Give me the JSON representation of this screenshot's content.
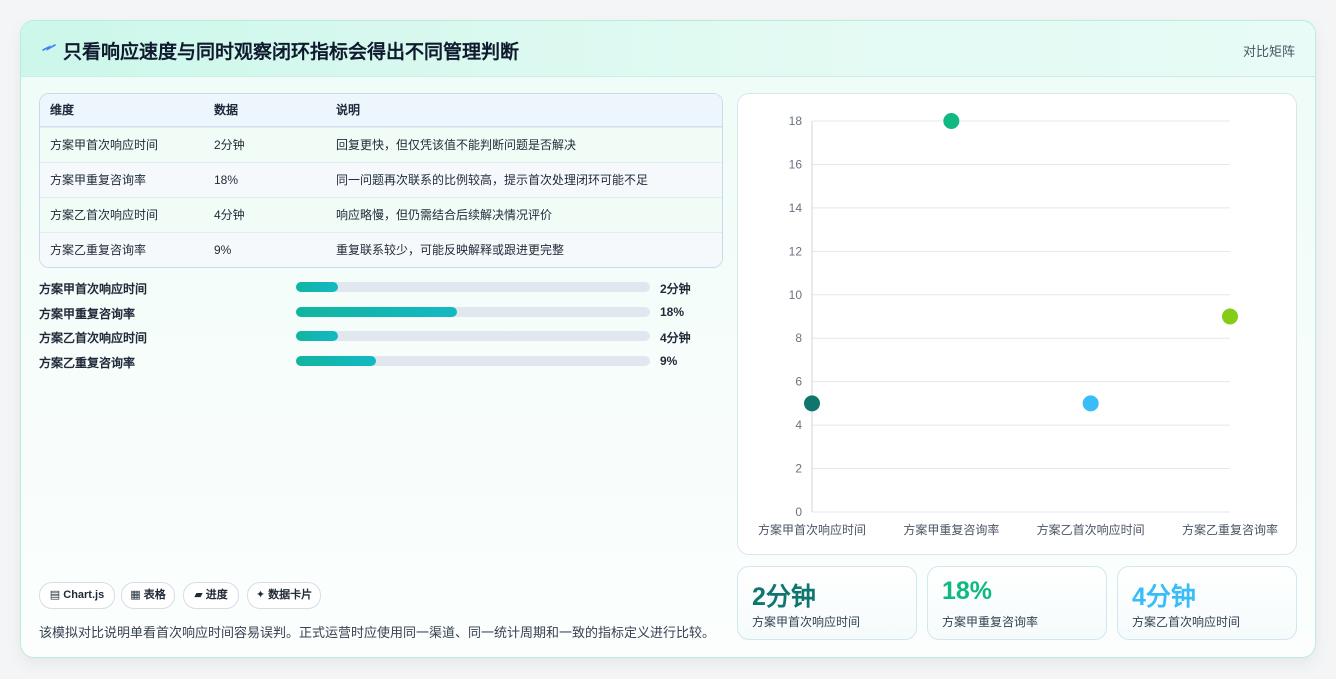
{
  "header": {
    "title": "只看响应速度与同时观察闭环指标会得出不同管理判断",
    "right_label": "对比矩阵"
  },
  "table": {
    "headers": [
      "维度",
      "数据",
      "说明"
    ],
    "rows": [
      [
        "方案甲首次响应时间",
        "2分钟",
        "回复更快，但仅凭该值不能判断问题是否解决"
      ],
      [
        "方案甲重复咨询率",
        "18%",
        "同一问题再次联系的比例较高，提示首次处理闭环可能不足"
      ],
      [
        "方案乙首次响应时间",
        "4分钟",
        "响应略慢，但仍需结合后续解决情况评价"
      ],
      [
        "方案乙重复咨询率",
        "9%",
        "重复联系较少，可能反映解释或跟进更完整"
      ]
    ]
  },
  "progress": [
    {
      "label": "方案甲首次响应时间",
      "value": "2分钟",
      "fraction": 0.12
    },
    {
      "label": "方案甲重复咨询率",
      "value": "18%",
      "fraction": 0.455
    },
    {
      "label": "方案乙首次响应时间",
      "value": "4分钟",
      "fraction": 0.12
    },
    {
      "label": "方案乙重复咨询率",
      "value": "9%",
      "fraction": 0.225
    }
  ],
  "chips": [
    "▤ Chart.js",
    "▦ 表格",
    "▰ 进度",
    "✦ 数据卡片"
  ],
  "note": "该模拟对比说明单看首次响应时间容易误判。正式运营时应使用同一渠道、同一统计周期和一致的指标定义进行比较。",
  "stats": [
    {
      "value": "2分钟",
      "label": "方案甲首次响应时间",
      "color": "#0f766e"
    },
    {
      "value": "18%",
      "label": "方案甲重复咨询率",
      "color": "#10b981"
    },
    {
      "value": "4分钟",
      "label": "方案乙首次响应时间",
      "color": "#38bdf8"
    }
  ],
  "chart_data": {
    "type": "scatter",
    "categories": [
      "方案甲首次响应时间",
      "方案甲重复咨询率",
      "方案乙首次响应时间",
      "方案乙重复咨询率"
    ],
    "values": [
      5,
      18,
      5,
      9
    ],
    "colors": [
      "#0f766e",
      "#10b981",
      "#38bdf8",
      "#84cc16"
    ],
    "ylim": [
      0,
      18
    ],
    "yticks": [
      "0",
      "2",
      "4",
      "6",
      "8",
      "10",
      "12",
      "14",
      "16",
      "18"
    ],
    "grid": true
  }
}
